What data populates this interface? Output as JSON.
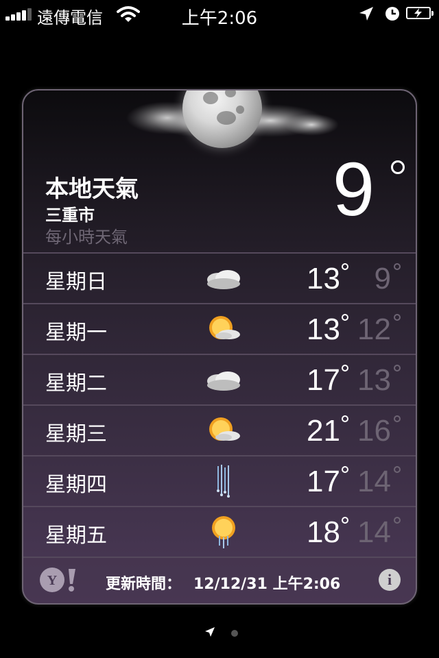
{
  "status_bar": {
    "carrier": "遠傳電信",
    "time": "上午2:06"
  },
  "current": {
    "title": "本地天氣",
    "city": "三重市",
    "hourly_link": "每小時天氣",
    "temperature": "9",
    "condition_icon": "moon-cloudy-icon"
  },
  "forecast": [
    {
      "day": "星期日",
      "icon": "cloudy-icon",
      "high": "13",
      "low": "9"
    },
    {
      "day": "星期一",
      "icon": "partly-sunny-icon",
      "high": "13",
      "low": "12"
    },
    {
      "day": "星期二",
      "icon": "cloudy-icon",
      "high": "17",
      "low": "13"
    },
    {
      "day": "星期三",
      "icon": "partly-sunny-icon",
      "high": "21",
      "low": "16"
    },
    {
      "day": "星期四",
      "icon": "rain-icon",
      "high": "17",
      "low": "14"
    },
    {
      "day": "星期五",
      "icon": "sun-rain-icon",
      "high": "18",
      "low": "14"
    }
  ],
  "footer": {
    "updated_label": "更新時間：",
    "updated_value": "12/12/31 上午2:06"
  },
  "colors": {
    "card_top": "#0c0b0e",
    "card_bottom": "#4b3957",
    "low_temp": "#6d6473",
    "divider": "#55495c"
  }
}
